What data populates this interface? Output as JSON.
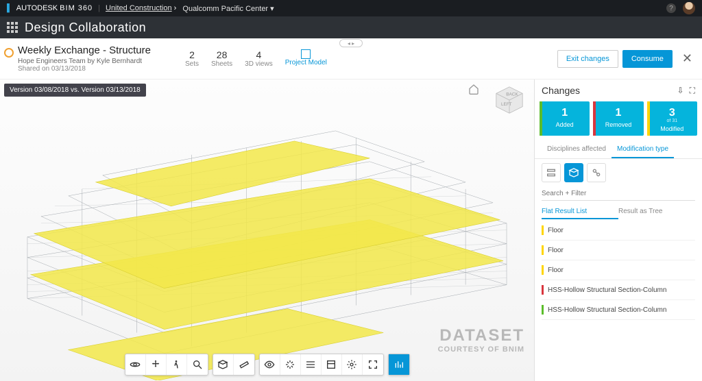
{
  "topbar": {
    "brand_prefix": "AUTODESK",
    "brand_product": "BIM 360",
    "crumb1": "United Construction",
    "crumb2": "Qualcomm Pacific Center",
    "help": "?"
  },
  "module_title": "Design Collaboration",
  "package": {
    "title": "Weekly Exchange - Structure",
    "byline": "Hope Engineers Team by Kyle Bernhardt",
    "shared": "Shared on 03/13/2018",
    "stats": [
      {
        "number": "2",
        "label": "Sets"
      },
      {
        "number": "28",
        "label": "Sheets"
      },
      {
        "number": "4",
        "label": "3D views"
      },
      {
        "label": "Project Model"
      }
    ],
    "exit_btn": "Exit changes",
    "consume_btn": "Consume"
  },
  "viewport": {
    "version_badge": "Version 03/08/2018 vs. Version 03/13/2018",
    "watermark_line1": "DATASET",
    "watermark_line2": "COURTESY OF BNIM"
  },
  "panel": {
    "title": "Changes",
    "cards": {
      "added": {
        "n": "1",
        "l": "Added"
      },
      "removed": {
        "n": "1",
        "l": "Removed"
      },
      "modified": {
        "n": "3",
        "sub": "of 31",
        "l": "Modified"
      }
    },
    "tab_disciplines": "Disciplines affected",
    "tab_modtype": "Modification type",
    "search_placeholder": "Search + Filter",
    "tab_flat": "Flat Result List",
    "tab_tree": "Result as Tree",
    "results": [
      {
        "type": "modified",
        "label": "Floor"
      },
      {
        "type": "modified",
        "label": "Floor"
      },
      {
        "type": "modified",
        "label": "Floor"
      },
      {
        "type": "removed",
        "label": "HSS-Hollow Structural Section-Column"
      },
      {
        "type": "added",
        "label": "HSS-Hollow Structural Section-Column"
      }
    ]
  }
}
